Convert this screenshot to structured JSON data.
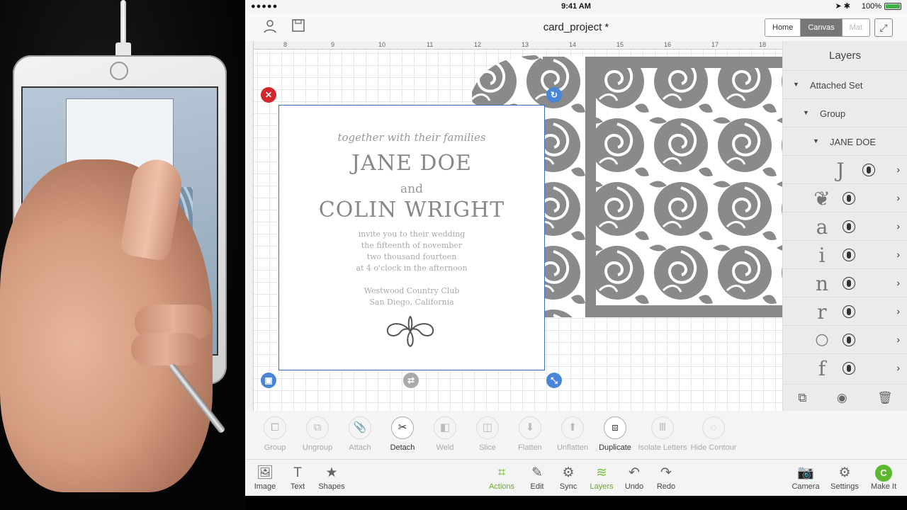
{
  "statusbar": {
    "carrier": "●●●●● ",
    "time": "9:41 AM",
    "battery": "100%",
    "location": "➤ ✱"
  },
  "topbar": {
    "title": "card_project *",
    "seg_home": "Home",
    "seg_canvas": "Canvas",
    "seg_mat": "Mat"
  },
  "ruler": {
    "n8": "8",
    "n9": "9",
    "n10": "10",
    "n11": "11",
    "n12": "12",
    "n13": "13",
    "n14": "14",
    "n15": "15",
    "n16": "16",
    "n17": "17",
    "n18": "18"
  },
  "card": {
    "line1": "together with their families",
    "line2": "JANE DOE",
    "line3": "and",
    "line4": "COLIN WRIGHT",
    "line5a": "invite you to their wedding",
    "line5b": "the fifteenth of november",
    "line5c": "two thousand fourteen",
    "line5d": "at 4 o'clock in the afternoon",
    "line6a": "Westwood Country Club",
    "line6b": "San Diego, California"
  },
  "layers": {
    "title": "Layers",
    "attached_set": "Attached Set",
    "group": "Group",
    "jane_doe": "JANE DOE",
    "glyphs": [
      "J",
      "❦",
      "a",
      "i",
      "n",
      "r",
      "○",
      "f"
    ]
  },
  "actions": {
    "group": "Group",
    "ungroup": "Ungroup",
    "attach": "Attach",
    "detach": "Detach",
    "weld": "Weld",
    "slice": "Slice",
    "flatten": "Flatten",
    "unflatten": "Unflatten",
    "duplicate": "Duplicate",
    "isolate": "Isolate Letters",
    "hide_contour": "Hide Contour"
  },
  "nav": {
    "image": "Image",
    "text": "Text",
    "shapes": "Shapes",
    "actions": "Actions",
    "edit": "Edit",
    "sync": "Sync",
    "layers": "Layers",
    "undo": "Undo",
    "redo": "Redo",
    "camera": "Camera",
    "settings": "Settings",
    "makeit": "Make It"
  },
  "colors": {
    "accent_green": "#7ac142",
    "selection_blue": "#4a86d6",
    "close_red": "#d0282c",
    "rose_gray": "#8a8a8a"
  }
}
